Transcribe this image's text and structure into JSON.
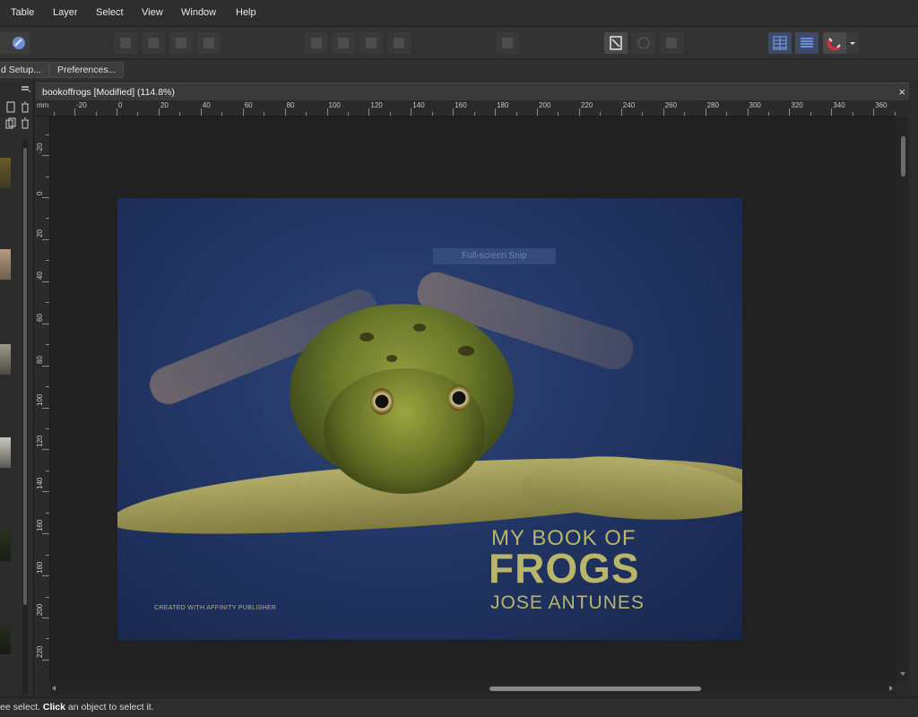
{
  "menu": [
    "Table",
    "Layer",
    "Select",
    "View",
    "Window",
    "Help"
  ],
  "context": {
    "document_setup_label": "d Setup...",
    "preferences_label": "Preferences..."
  },
  "document": {
    "tab_title": "bookoffrogs [Modified] (114.8%)",
    "close_glyph": "×"
  },
  "ruler": {
    "unit": "mm",
    "h_labels": [
      "-20",
      "0",
      "20",
      "40",
      "60",
      "80",
      "100",
      "120",
      "140",
      "160",
      "180",
      "200",
      "220",
      "240",
      "260",
      "280",
      "300",
      "320",
      "340",
      "360"
    ],
    "v_labels": [
      "-20",
      "0",
      "20",
      "40",
      "60",
      "80",
      "100",
      "120",
      "140",
      "160",
      "180",
      "200",
      "220"
    ]
  },
  "cover": {
    "title_line1": "MY BOOK OF",
    "title_line2": "FROGS",
    "author": "JOSE ANTUNES",
    "credit": "CREATED WITH AFFINITY PUBLISHER",
    "snip_tooltip": "Full-screen Snip"
  },
  "status": {
    "prefix": "ee select. ",
    "bold": "Click",
    "suffix": " an object to select it."
  },
  "colors": {
    "title_text": "#b9b56a",
    "accent_magnet": "#d0303a"
  }
}
